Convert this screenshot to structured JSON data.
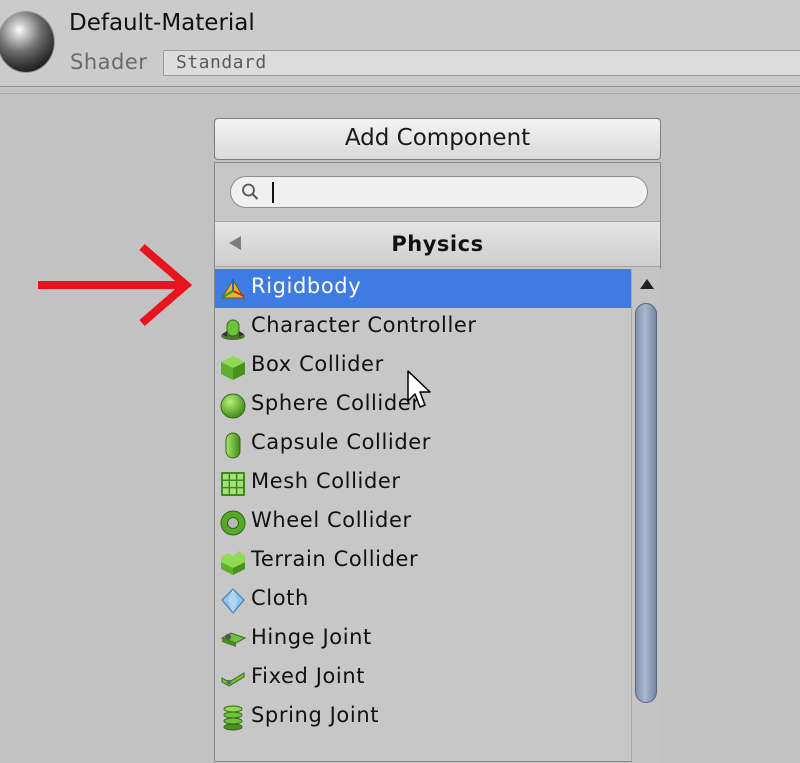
{
  "header": {
    "title": "Default-Material",
    "shader_label": "Shader",
    "shader_value": "Standard",
    "icon": "material-sphere-icon"
  },
  "add_component": {
    "label": "Add Component"
  },
  "search": {
    "value": "",
    "placeholder": "",
    "icon": "search-icon"
  },
  "category": {
    "title": "Physics",
    "back_icon": "back-arrow-icon"
  },
  "items": [
    {
      "label": "Rigidbody",
      "icon": "rigidbody-icon",
      "selected": true
    },
    {
      "label": "Character Controller",
      "icon": "character-controller-icon"
    },
    {
      "label": "Box Collider",
      "icon": "box-collider-icon"
    },
    {
      "label": "Sphere Collider",
      "icon": "sphere-collider-icon"
    },
    {
      "label": "Capsule Collider",
      "icon": "capsule-collider-icon"
    },
    {
      "label": "Mesh Collider",
      "icon": "mesh-collider-icon"
    },
    {
      "label": "Wheel Collider",
      "icon": "wheel-collider-icon"
    },
    {
      "label": "Terrain Collider",
      "icon": "terrain-collider-icon"
    },
    {
      "label": "Cloth",
      "icon": "cloth-icon"
    },
    {
      "label": "Hinge Joint",
      "icon": "hinge-joint-icon"
    },
    {
      "label": "Fixed Joint",
      "icon": "fixed-joint-icon"
    },
    {
      "label": "Spring Joint",
      "icon": "spring-joint-icon"
    }
  ],
  "colors": {
    "selection": "#3e7ce4",
    "annotation_arrow": "#e8141e",
    "collider_green": "#6cc23a"
  }
}
